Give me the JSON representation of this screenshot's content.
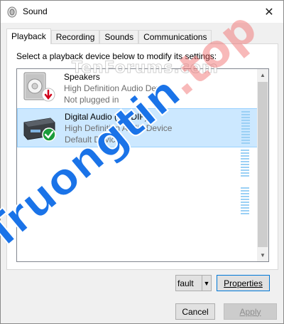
{
  "window": {
    "title": "Sound",
    "close_glyph": "✕"
  },
  "tabs": [
    {
      "label": "Playback",
      "active": true
    },
    {
      "label": "Recording",
      "active": false
    },
    {
      "label": "Sounds",
      "active": false
    },
    {
      "label": "Communications",
      "active": false
    }
  ],
  "panel": {
    "instruction": "Select a playback device below to modify its settings:"
  },
  "devices": [
    {
      "name": "Speakers",
      "driver": "High Definition Audio Device",
      "status": "Not plugged in",
      "icon": "speaker-icon",
      "badge": "unplugged-red-arrow-icon",
      "selected": false
    },
    {
      "name": "Digital Audio (S/PDIF)",
      "driver": "High Definition Audio Device",
      "status": "Default Device",
      "icon": "digital-audio-device-icon",
      "badge": "default-green-check-icon",
      "selected": true
    }
  ],
  "buttons": {
    "set_default_partial": "fault",
    "dropdown_arrow": "▼",
    "properties": "Properties",
    "cancel": "Cancel",
    "apply": "Apply"
  },
  "watermarks": {
    "top": "TenForums.com",
    "bottom": "Truongtin",
    "bottom_suffix": ".top"
  },
  "colors": {
    "selection_bg": "#cce8ff",
    "selection_border": "#99d1ff",
    "level_meter": "#9bd0f5",
    "focus_border": "#0078d7",
    "watermark_blue": "#1a73e8",
    "watermark_pink": "#f06464"
  }
}
